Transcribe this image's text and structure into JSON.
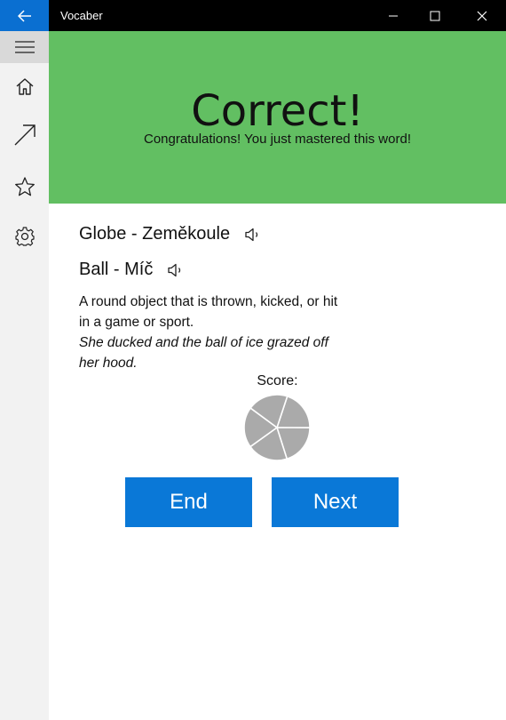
{
  "window": {
    "title": "Vocaber",
    "controls": [
      "minimize-icon",
      "maximize-icon",
      "close-icon"
    ]
  },
  "sidebar": {
    "items": [
      {
        "icon": "hamburger-icon"
      },
      {
        "icon": "home-icon"
      },
      {
        "icon": "arrow-up-right-icon"
      },
      {
        "icon": "star-icon"
      },
      {
        "icon": "gear-icon"
      }
    ]
  },
  "banner": {
    "title": "Correct!",
    "subtitle": "Congratulations! You just mastered this word!",
    "color": "#62bf62"
  },
  "words": [
    {
      "text": "Globe - Zeměkoule",
      "icon": "speaker-icon"
    },
    {
      "text": "Ball - Míč",
      "icon": "speaker-icon"
    }
  ],
  "definition": "A round object that is thrown, kicked, or hit in a game or sport.",
  "example": "She ducked and the ball of ice grazed off her hood.",
  "score": {
    "label": "Score:",
    "filled_segments": 5,
    "total_segments": 5,
    "color": "#aaaaaa"
  },
  "buttons": {
    "end": "End",
    "next": "Next",
    "color": "#0a78d7"
  }
}
